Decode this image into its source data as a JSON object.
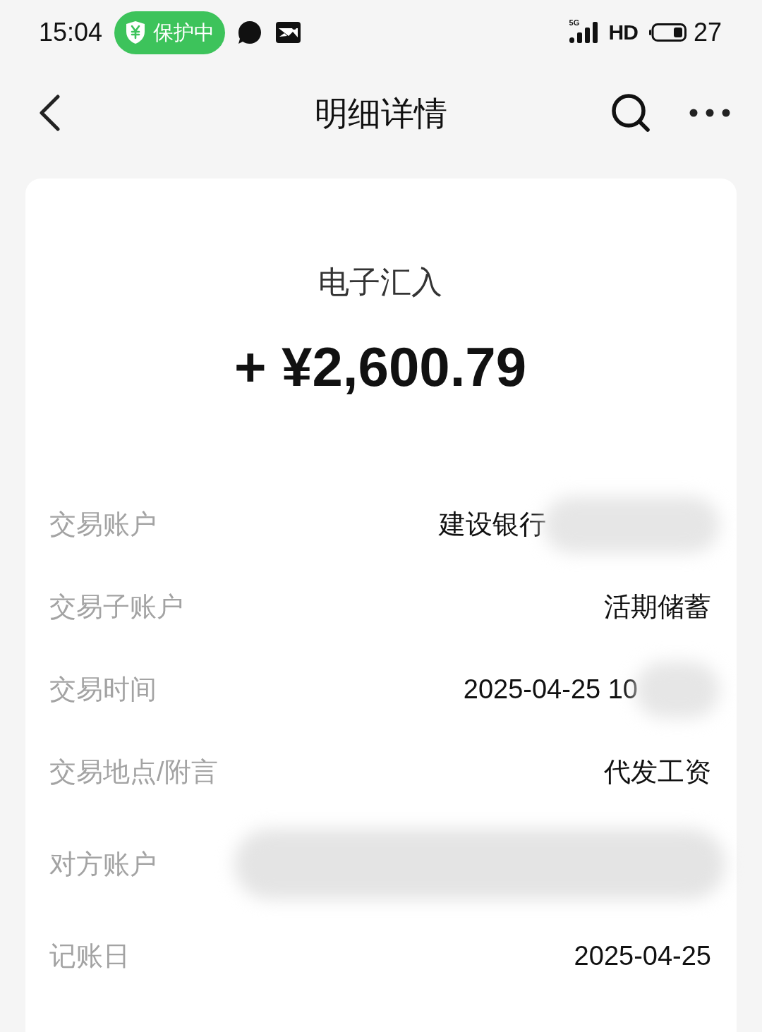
{
  "status_bar": {
    "time": "15:04",
    "protection_badge": {
      "label": "保护中"
    },
    "network": "5G",
    "hd": "HD",
    "battery": "27"
  },
  "header": {
    "title": "明细详情"
  },
  "transaction": {
    "type": "电子汇入",
    "amount": "+ ¥2,600.79"
  },
  "details": [
    {
      "label": "交易账户",
      "value": "建设银行",
      "redacted": true
    },
    {
      "label": "交易子账户",
      "value": "活期储蓄",
      "redacted": false
    },
    {
      "label": "交易时间",
      "value": "2025-04-25 10",
      "redacted": true
    },
    {
      "label": "交易地点/附言",
      "value": "代发工资",
      "redacted": false
    },
    {
      "label": "对方账户",
      "redacted": true
    },
    {
      "label": "记账日",
      "value": "2025-04-25",
      "redacted": false
    }
  ]
}
